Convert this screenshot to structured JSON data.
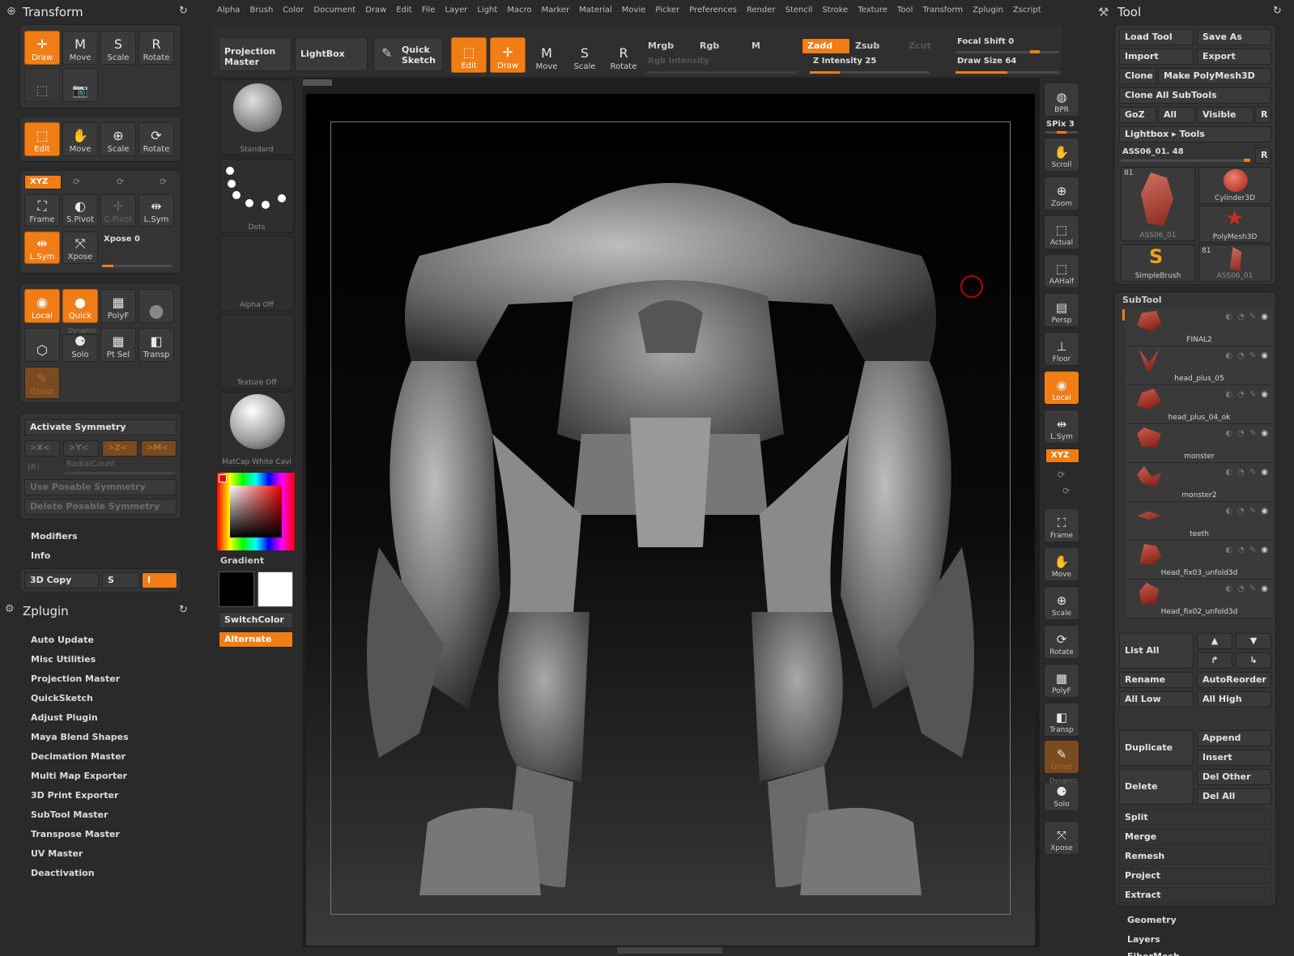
{
  "top_menu": [
    "Alpha",
    "Brush",
    "Color",
    "Document",
    "Draw",
    "Edit",
    "File",
    "Layer",
    "Light",
    "Macro",
    "Marker",
    "Material",
    "Movie",
    "Picker",
    "Preferences",
    "Render",
    "Stencil",
    "Stroke",
    "Texture",
    "Tool",
    "Transform",
    "Zplugin",
    "Zscript"
  ],
  "transform": {
    "title": "Transform",
    "row1": [
      "Draw",
      "Move",
      "Scale",
      "Rotate"
    ],
    "row2": [
      "Edit",
      "Move",
      "Scale",
      "Rotate"
    ],
    "xyz": "XYZ",
    "row3": [
      "Frame",
      "S.Pivot",
      "C.Pivot",
      "L.Sym"
    ],
    "row4": [
      "L.Sym",
      "Xpose"
    ],
    "xpose_label": "Xpose 0",
    "row5": [
      "Local",
      "Quick",
      "PolyF"
    ],
    "dynamic": "Dynamic",
    "row6": [
      "Solo",
      "Pt Sel",
      "Transp"
    ],
    "ghost": "Ghost"
  },
  "symmetry": {
    "activate": "Activate Symmetry",
    "axes": [
      ">X<",
      ">Y<",
      ">Z<",
      ">M<"
    ],
    "r_label": "(R)",
    "radial": "RadialCount",
    "use_posable": "Use Posable Symmetry",
    "delete_posable": "Delete Posable Symmetry"
  },
  "modifiers": "Modifiers",
  "info": "Info",
  "copy3d": {
    "label": "3D Copy",
    "s": "S",
    "i": "I"
  },
  "zplugin": {
    "title": "Zplugin",
    "items": [
      "Auto Update",
      "Misc Utilities",
      "Projection Master",
      "QuickSketch",
      "Adjust Plugin",
      "Maya Blend Shapes",
      "Decimation Master",
      "Multi Map Exporter",
      "3D Print Exporter",
      "SubTool Master",
      "Transpose Master",
      "UV Master",
      "Deactivation"
    ]
  },
  "shelf": {
    "projection_master": "Projection Master",
    "lightbox": "LightBox",
    "quick_sketch": "Quick Sketch",
    "edit": "Edit",
    "draw": "Draw",
    "move": "Move",
    "scale": "Scale",
    "rotate": "Rotate",
    "mrgb": "Mrgb",
    "rgb": "Rgb",
    "m": "M",
    "zadd": "Zadd",
    "zsub": "Zsub",
    "zcut": "Zcut",
    "rgb_intensity": "Rgb Intensity",
    "z_intensity": "Z Intensity 25",
    "z_intensity_value": 0.25,
    "focal_shift": "Focal Shift 0",
    "draw_size": "Draw Size 64",
    "draw_size_value": 0.5
  },
  "left_shelf": {
    "brush": "Standard",
    "stroke": "Dots",
    "alpha": "Alpha Off",
    "texture": "Texture Off",
    "material": "MatCap White Cavi",
    "gradient": "Gradient",
    "switch_color": "SwitchColor",
    "alternate": "Alternate"
  },
  "right_shelf": {
    "bpr": "BPR",
    "spix": "SPix 3",
    "buttons": [
      "Scroll",
      "Zoom",
      "Actual",
      "AAHalf",
      "Persp",
      "Floor",
      "Local",
      "L.Sym",
      "XYZ",
      "Frame",
      "Move",
      "Scale",
      "Rotate",
      "PolyF",
      "Transp",
      "Ghost",
      "Solo",
      "Xpose"
    ],
    "dynamic": "Dynamic"
  },
  "tool": {
    "title": "Tool",
    "load_tool": "Load Tool",
    "save_as": "Save As",
    "import": "Import",
    "export": "Export",
    "clone": "Clone",
    "make_polymesh": "Make PolyMesh3D",
    "clone_all": "Clone All SubTools",
    "goz": "GoZ",
    "all": "All",
    "visible": "Visible",
    "r": "R",
    "lightbox_tools": "Lightbox ▸ Tools",
    "current": "ASS06_01. 48",
    "thumbs": [
      {
        "name": "ASS06_01",
        "count": "81"
      },
      {
        "name": "Cylinder3D",
        "count": ""
      },
      {
        "name": "PolyMesh3D",
        "count": ""
      },
      {
        "name": "SimpleBrush",
        "count": ""
      },
      {
        "name": "ASS06_01",
        "count": "81"
      }
    ],
    "subtool_title": "SubTool",
    "subtools": [
      "FINAL2",
      "head_plus_05",
      "head_plus_04_ok",
      "monster",
      "monster2",
      "teeth",
      "Head_fix03_unfold3d",
      "Head_fix02_unfold3d"
    ],
    "list_all": "List All",
    "rename": "Rename",
    "auto_reorder": "AutoReorder",
    "all_low": "All Low",
    "all_high": "All High",
    "duplicate": "Duplicate",
    "append": "Append",
    "insert": "Insert",
    "delete": "Delete",
    "del_other": "Del Other",
    "del_all": "Del All",
    "split": "Split",
    "merge": "Merge",
    "remesh": "Remesh",
    "project": "Project",
    "extract": "Extract",
    "geometry": "Geometry",
    "layers": "Layers",
    "fiber": "FiberMesh"
  },
  "colors": {
    "accent": "#f07d16",
    "panel": "#343434",
    "canvas": "#1e1e1e"
  }
}
